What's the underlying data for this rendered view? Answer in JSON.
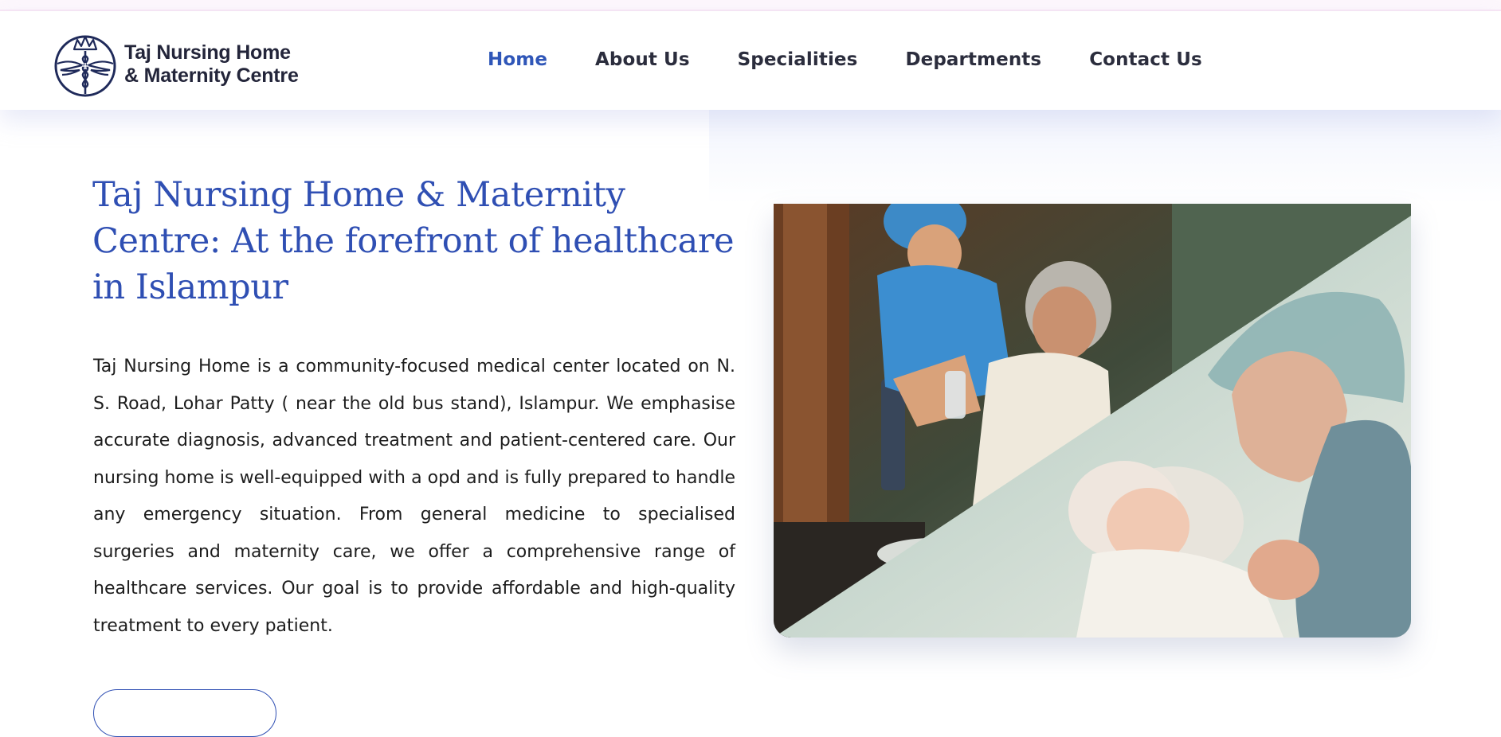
{
  "brand": {
    "name_line1": "Taj Nursing Home",
    "name_line2": "& Maternity Centre",
    "logo_icon": "caduceus-crown-logo"
  },
  "nav": {
    "items": [
      {
        "label": "Home",
        "active": true
      },
      {
        "label": "About Us",
        "active": false
      },
      {
        "label": "Specialities",
        "active": false
      },
      {
        "label": "Departments",
        "active": false
      },
      {
        "label": "Contact Us",
        "active": false
      }
    ]
  },
  "hero": {
    "title": "Taj Nursing Home & Maternity Centre: At the forefront of healthcare in Islampur",
    "description": "Taj Nursing Home is a community-focused medical center located on N. S. Road, Lohar Patty ( near the old bus stand), Islampur. We emphasise accurate diagnosis, advanced treatment and patient-centered care. Our nursing home is well-equipped with a opd and is fully prepared to handle any emergency situation. From general medicine to specialised surgeries and maternity care, we offer a comprehensive range of healthcare services. Our goal is to provide affordable and high-quality treatment to every patient.",
    "image": "nurse-with-elderly-patient-and-mother-with-newborn-photo"
  },
  "colors": {
    "brand_blue": "#2f4fb3",
    "nav_active": "#2f56b8",
    "nav_text": "#2b2d3d",
    "body_text": "#1d1d1d"
  }
}
